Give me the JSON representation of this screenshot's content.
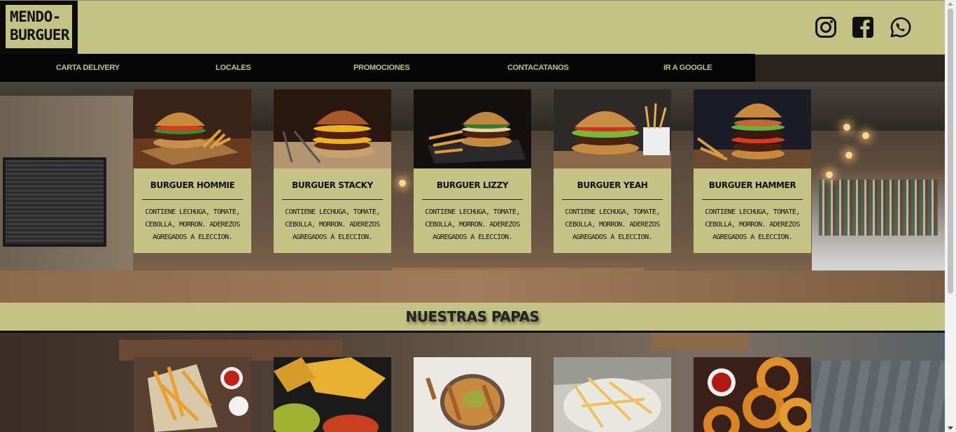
{
  "brand": {
    "logo_line1": "MENDO-",
    "logo_line2": "BURGUER"
  },
  "social": [
    "instagram-icon",
    "facebook-icon",
    "whatsapp-icon"
  ],
  "nav": {
    "items": [
      "CARTA DELIVERY",
      "LOCALES",
      "PROMOCIONES",
      "CONTACATANOS",
      "IR A GOOGLE"
    ]
  },
  "burgers": [
    {
      "name": "BURGUER HOMMIE",
      "desc": "CONTIENE LECHUGA, TOMATE, CEBOLLA, MORRON. ADEREZOS AGREGADOS A ELECCION."
    },
    {
      "name": "BURGUER STACKY",
      "desc": "CONTIENE LECHUGA, TOMATE, CEBOLLA, MORRON. ADEREZOS AGREGADOS A ELECCION."
    },
    {
      "name": "BURGUER LIZZY",
      "desc": "CONTIENE LECHUGA, TOMATE, CEBOLLA, MORRON. ADEREZOS AGREGADOS A ELECCION."
    },
    {
      "name": "BURGUER YEAH",
      "desc": "CONTIENE LECHUGA, TOMATE, CEBOLLA, MORRON. ADEREZOS AGREGADOS A ELECCION."
    },
    {
      "name": "BURGUER HAMMER",
      "desc": "CONTIENE LECHUGA, TOMATE, CEBOLLA, MORRON. ADEREZOS AGREGADOS A ELECCION."
    }
  ],
  "section": {
    "papas_title": "NUESTRAS PAPAS"
  },
  "colors": {
    "accent": "#c4c285",
    "dark": "#050505"
  }
}
